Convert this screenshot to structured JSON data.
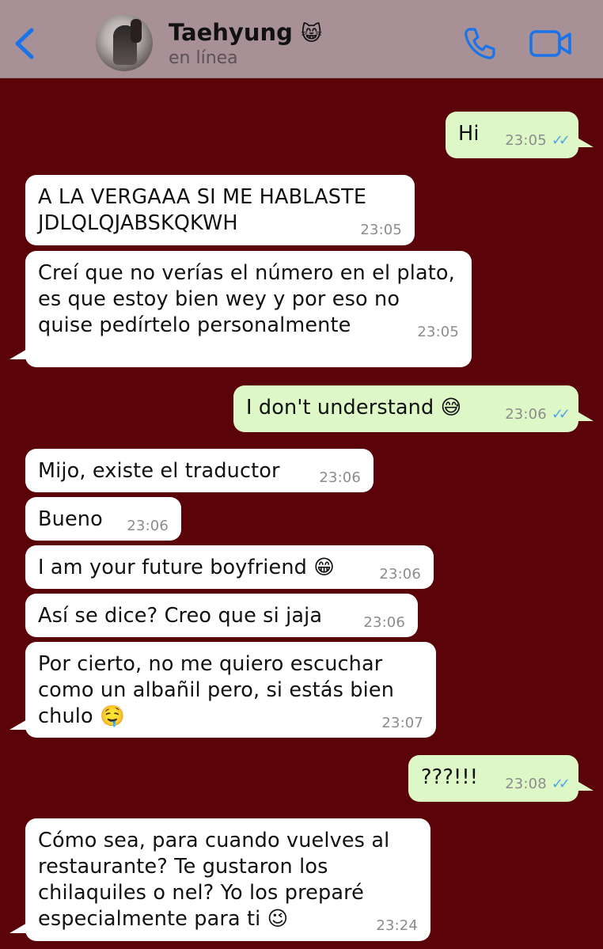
{
  "header": {
    "back_icon": "chevron-left-icon",
    "contact_name": "Taehyung",
    "contact_emoji": "😸",
    "status": "en línea",
    "call_icon": "phone-icon",
    "video_icon": "video-camera-icon",
    "accent_color": "#1a73e8"
  },
  "messages": [
    {
      "dir": "out",
      "text": "Hi",
      "time": "23:05",
      "ticks": "✓✓"
    },
    {
      "dir": "in",
      "text": "A LA VERGAAA SI ME HABLASTE JDLQLQJABSKQKWH",
      "time": "23:05"
    },
    {
      "dir": "in",
      "text": "Creí que no verías el número en el plato, es que estoy bien wey y por eso no quise pedírtelo personalmente",
      "time": "23:05"
    },
    {
      "dir": "out",
      "text": "I don't understand 😅",
      "time": "23:06",
      "ticks": "✓✓"
    },
    {
      "dir": "in",
      "text": "Mijo, existe el traductor",
      "time": "23:06"
    },
    {
      "dir": "in",
      "text": "Bueno",
      "time": "23:06"
    },
    {
      "dir": "in",
      "text": "I am your future boyfriend 😁",
      "time": "23:06"
    },
    {
      "dir": "in",
      "text": "Así se dice? Creo que si jaja",
      "time": "23:06"
    },
    {
      "dir": "in",
      "text": "Por cierto, no me quiero escuchar como un albañil pero, si estás bien chulo 🤤",
      "time": "23:07"
    },
    {
      "dir": "out",
      "text": "???!!!",
      "time": "23:08",
      "ticks": "✓✓"
    },
    {
      "dir": "in",
      "text": "Cómo sea, para cuando vuelves al restaurante? Te gustaron los chilaquiles o nel? Yo los preparé especialmente para ti 😉",
      "time": "23:24"
    }
  ]
}
